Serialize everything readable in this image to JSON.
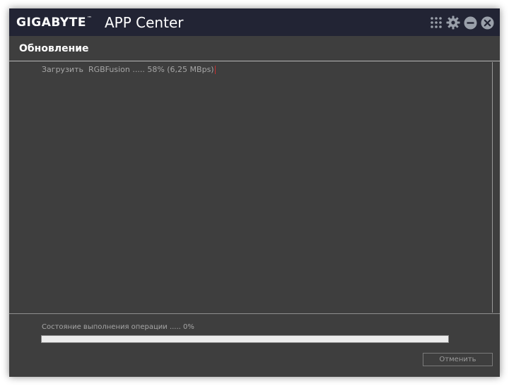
{
  "window": {
    "brand": "GIGABYTE",
    "brand_mark": "™",
    "app_title": "APP Center",
    "controls": {
      "apps_icon": "grid-icon",
      "settings_icon": "gear-icon",
      "minimize_icon": "minimize-icon",
      "close_icon": "close-icon"
    }
  },
  "section": {
    "title": "Обновление"
  },
  "log": {
    "line": "Загрузить  RGBFusion ..... 58% (6,25 MBps)"
  },
  "status": {
    "text": "Состояние выполнения операции ..... 0%",
    "progress_percent": 0
  },
  "actions": {
    "cancel_label": "Отменить"
  },
  "colors": {
    "titlebar": "#222434",
    "body": "#3e3e3e",
    "text_dim": "#a6a6a6",
    "caret": "#c63030"
  }
}
